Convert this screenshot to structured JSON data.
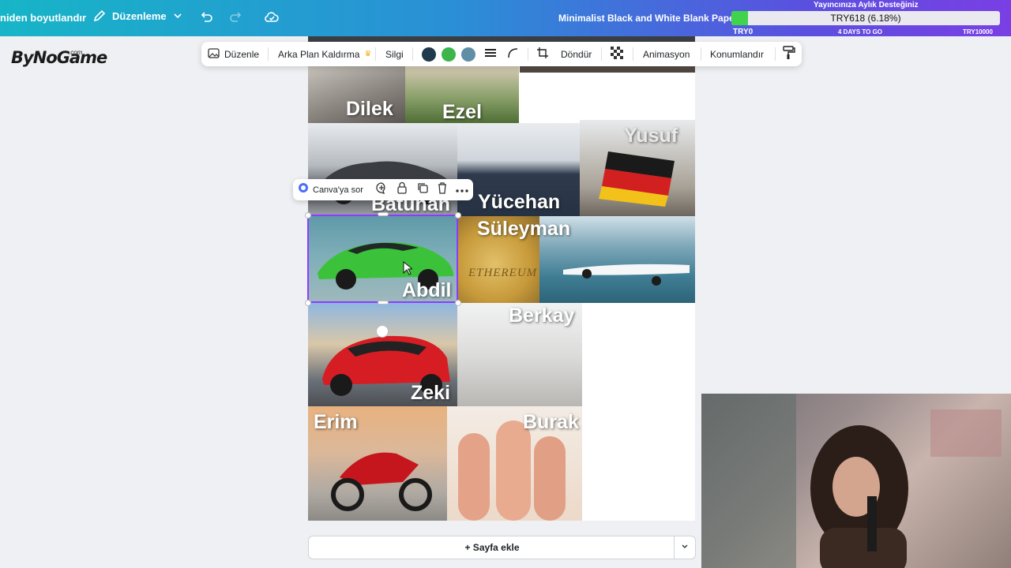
{
  "topbar": {
    "resize_label": "niden boyutlandır",
    "edit_label": "Düzenleme",
    "doc_title": "Minimalist Black and White Blank Paper D"
  },
  "donation": {
    "title": "Yayıncınıza Aylık Desteğiniz",
    "amount": "TRY618 (6.18%)",
    "progress": 0.0618,
    "min_label": "TRY0",
    "days_left": "4 DAYS TO GO",
    "max_label": "TRY10000"
  },
  "logo": {
    "text": "ByNoGame",
    "suffix": ".com"
  },
  "toolbar": {
    "edit": "Düzenle",
    "bg_remove": "Arka Plan Kaldırma",
    "eraser": "Silgi",
    "colors": [
      "#1f3a4d",
      "#3cb54a",
      "#5f8ea5"
    ],
    "rotate": "Döndür",
    "animate": "Animasyon",
    "position": "Konumlandır"
  },
  "context_menu": {
    "ask": "Canva'ya sor"
  },
  "tiles": [
    {
      "name": "Dilek"
    },
    {
      "name": "Ezel"
    },
    {
      "name": "Yusuf"
    },
    {
      "name": "Batuhan"
    },
    {
      "name": "Yücehan"
    },
    {
      "name": "Süleyman"
    },
    {
      "name": "Abdil"
    },
    {
      "name": "Berkay"
    },
    {
      "name": "Zeki"
    },
    {
      "name": "Erim"
    },
    {
      "name": "Burak"
    }
  ],
  "photo_text": {
    "ethereum": "ETHEREUM"
  },
  "add_page": "+ Sayfa ekle"
}
